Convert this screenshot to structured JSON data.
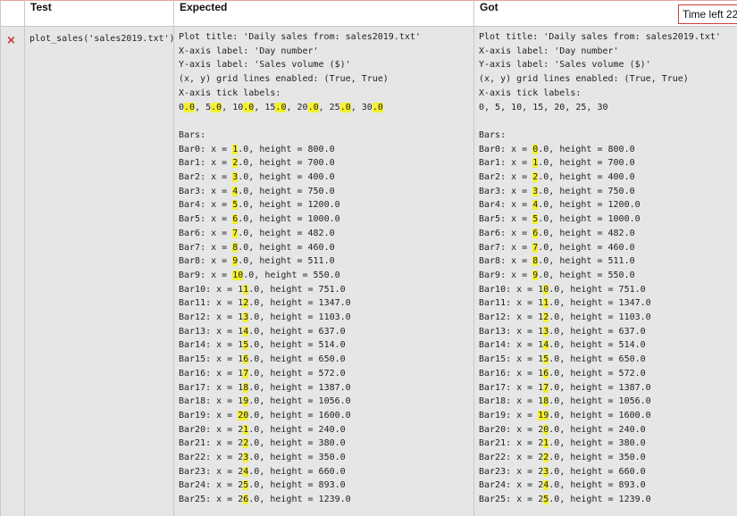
{
  "table": {
    "headers": {
      "icon": "",
      "test": "Test",
      "expected": "Expected",
      "got": "Got"
    },
    "row": {
      "status_icon": "×",
      "test_call": "plot_sales('sales2019.txt')",
      "expected_lines": [
        [
          {
            "t": "Plot title: 'Daily sales from: sales2019.txt'"
          }
        ],
        [
          {
            "t": "X-axis label: 'Day number'"
          }
        ],
        [
          {
            "t": "Y-axis label: 'Sales volume ($)'"
          }
        ],
        [
          {
            "t": "(x, y) grid lines enabled: (True, True)"
          }
        ],
        [
          {
            "t": "X-axis tick labels:"
          }
        ],
        [
          {
            "t": "0"
          },
          {
            "t": ".0",
            "h": true
          },
          {
            "t": ", 5"
          },
          {
            "t": ".0",
            "h": true
          },
          {
            "t": ", 10"
          },
          {
            "t": ".0",
            "h": true
          },
          {
            "t": ", 15"
          },
          {
            "t": ".0",
            "h": true
          },
          {
            "t": ", 20"
          },
          {
            "t": ".0",
            "h": true
          },
          {
            "t": ", 25"
          },
          {
            "t": ".0",
            "h": true
          },
          {
            "t": ", 30"
          },
          {
            "t": ".0",
            "h": true
          }
        ],
        [],
        [
          {
            "t": "Bars:"
          }
        ],
        [
          {
            "t": "Bar0: x = "
          },
          {
            "t": "1",
            "h": true
          },
          {
            "t": ".0, height = 800.0"
          }
        ],
        [
          {
            "t": "Bar1: x = "
          },
          {
            "t": "2",
            "h": true
          },
          {
            "t": ".0, height = 700.0"
          }
        ],
        [
          {
            "t": "Bar2: x = "
          },
          {
            "t": "3",
            "h": true
          },
          {
            "t": ".0, height = 400.0"
          }
        ],
        [
          {
            "t": "Bar3: x = "
          },
          {
            "t": "4",
            "h": true
          },
          {
            "t": ".0, height = 750.0"
          }
        ],
        [
          {
            "t": "Bar4: x = "
          },
          {
            "t": "5",
            "h": true
          },
          {
            "t": ".0, height = 1200.0"
          }
        ],
        [
          {
            "t": "Bar5: x = "
          },
          {
            "t": "6",
            "h": true
          },
          {
            "t": ".0, height = 1000.0"
          }
        ],
        [
          {
            "t": "Bar6: x = "
          },
          {
            "t": "7",
            "h": true
          },
          {
            "t": ".0, height = 482.0"
          }
        ],
        [
          {
            "t": "Bar7: x = "
          },
          {
            "t": "8",
            "h": true
          },
          {
            "t": ".0, height = 460.0"
          }
        ],
        [
          {
            "t": "Bar8: x = "
          },
          {
            "t": "9",
            "h": true
          },
          {
            "t": ".0, height = 511.0"
          }
        ],
        [
          {
            "t": "Bar9: x = "
          },
          {
            "t": "10",
            "h": true
          },
          {
            "t": ".0, height = 550.0"
          }
        ],
        [
          {
            "t": "Bar10: x = 1"
          },
          {
            "t": "1",
            "h": true
          },
          {
            "t": ".0, height = 751.0"
          }
        ],
        [
          {
            "t": "Bar11: x = 1"
          },
          {
            "t": "2",
            "h": true
          },
          {
            "t": ".0, height = 1347.0"
          }
        ],
        [
          {
            "t": "Bar12: x = 1"
          },
          {
            "t": "3",
            "h": true
          },
          {
            "t": ".0, height = 1103.0"
          }
        ],
        [
          {
            "t": "Bar13: x = 1"
          },
          {
            "t": "4",
            "h": true
          },
          {
            "t": ".0, height = 637.0"
          }
        ],
        [
          {
            "t": "Bar14: x = 1"
          },
          {
            "t": "5",
            "h": true
          },
          {
            "t": ".0, height = 514.0"
          }
        ],
        [
          {
            "t": "Bar15: x = 1"
          },
          {
            "t": "6",
            "h": true
          },
          {
            "t": ".0, height = 650.0"
          }
        ],
        [
          {
            "t": "Bar16: x = 1"
          },
          {
            "t": "7",
            "h": true
          },
          {
            "t": ".0, height = 572.0"
          }
        ],
        [
          {
            "t": "Bar17: x = 1"
          },
          {
            "t": "8",
            "h": true
          },
          {
            "t": ".0, height = 1387.0"
          }
        ],
        [
          {
            "t": "Bar18: x = 1"
          },
          {
            "t": "9",
            "h": true
          },
          {
            "t": ".0, height = 1056.0"
          }
        ],
        [
          {
            "t": "Bar19: x = "
          },
          {
            "t": "20",
            "h": true
          },
          {
            "t": ".0, height = 1600.0"
          }
        ],
        [
          {
            "t": "Bar20: x = 2"
          },
          {
            "t": "1",
            "h": true
          },
          {
            "t": ".0, height = 240.0"
          }
        ],
        [
          {
            "t": "Bar21: x = 2"
          },
          {
            "t": "2",
            "h": true
          },
          {
            "t": ".0, height = 380.0"
          }
        ],
        [
          {
            "t": "Bar22: x = 2"
          },
          {
            "t": "3",
            "h": true
          },
          {
            "t": ".0, height = 350.0"
          }
        ],
        [
          {
            "t": "Bar23: x = 2"
          },
          {
            "t": "4",
            "h": true
          },
          {
            "t": ".0, height = 660.0"
          }
        ],
        [
          {
            "t": "Bar24: x = 2"
          },
          {
            "t": "5",
            "h": true
          },
          {
            "t": ".0, height = 893.0"
          }
        ],
        [
          {
            "t": "Bar25: x = 2"
          },
          {
            "t": "6",
            "h": true
          },
          {
            "t": ".0, height = 1239.0"
          }
        ]
      ],
      "got_lines": [
        [
          {
            "t": "Plot title: 'Daily sales from: sales2019.txt'"
          }
        ],
        [
          {
            "t": "X-axis label: 'Day number'"
          }
        ],
        [
          {
            "t": "Y-axis label: 'Sales volume ($)'"
          }
        ],
        [
          {
            "t": "(x, y) grid lines enabled: (True, True)"
          }
        ],
        [
          {
            "t": "X-axis tick labels:"
          }
        ],
        [
          {
            "t": "0, 5, 10, 15, 20, 25, 30"
          }
        ],
        [],
        [
          {
            "t": "Bars:"
          }
        ],
        [
          {
            "t": "Bar0: x = "
          },
          {
            "t": "0",
            "h": true
          },
          {
            "t": ".0, height = 800.0"
          }
        ],
        [
          {
            "t": "Bar1: x = "
          },
          {
            "t": "1",
            "h": true
          },
          {
            "t": ".0, height = 700.0"
          }
        ],
        [
          {
            "t": "Bar2: x = "
          },
          {
            "t": "2",
            "h": true
          },
          {
            "t": ".0, height = 400.0"
          }
        ],
        [
          {
            "t": "Bar3: x = "
          },
          {
            "t": "3",
            "h": true
          },
          {
            "t": ".0, height = 750.0"
          }
        ],
        [
          {
            "t": "Bar4: x = "
          },
          {
            "t": "4",
            "h": true
          },
          {
            "t": ".0, height = 1200.0"
          }
        ],
        [
          {
            "t": "Bar5: x = "
          },
          {
            "t": "5",
            "h": true
          },
          {
            "t": ".0, height = 1000.0"
          }
        ],
        [
          {
            "t": "Bar6: x = "
          },
          {
            "t": "6",
            "h": true
          },
          {
            "t": ".0, height = 482.0"
          }
        ],
        [
          {
            "t": "Bar7: x = "
          },
          {
            "t": "7",
            "h": true
          },
          {
            "t": ".0, height = 460.0"
          }
        ],
        [
          {
            "t": "Bar8: x = "
          },
          {
            "t": "8",
            "h": true
          },
          {
            "t": ".0, height = 511.0"
          }
        ],
        [
          {
            "t": "Bar9: x = "
          },
          {
            "t": "9",
            "h": true
          },
          {
            "t": ".0, height = 550.0"
          }
        ],
        [
          {
            "t": "Bar10: x = 1"
          },
          {
            "t": "0",
            "h": true
          },
          {
            "t": ".0, height = 751.0"
          }
        ],
        [
          {
            "t": "Bar11: x = 1"
          },
          {
            "t": "1",
            "h": true
          },
          {
            "t": ".0, height = 1347.0"
          }
        ],
        [
          {
            "t": "Bar12: x = 1"
          },
          {
            "t": "2",
            "h": true
          },
          {
            "t": ".0, height = 1103.0"
          }
        ],
        [
          {
            "t": "Bar13: x = 1"
          },
          {
            "t": "3",
            "h": true
          },
          {
            "t": ".0, height = 637.0"
          }
        ],
        [
          {
            "t": "Bar14: x = 1"
          },
          {
            "t": "4",
            "h": true
          },
          {
            "t": ".0, height = 514.0"
          }
        ],
        [
          {
            "t": "Bar15: x = 1"
          },
          {
            "t": "5",
            "h": true
          },
          {
            "t": ".0, height = 650.0"
          }
        ],
        [
          {
            "t": "Bar16: x = 1"
          },
          {
            "t": "6",
            "h": true
          },
          {
            "t": ".0, height = 572.0"
          }
        ],
        [
          {
            "t": "Bar17: x = 1"
          },
          {
            "t": "7",
            "h": true
          },
          {
            "t": ".0, height = 1387.0"
          }
        ],
        [
          {
            "t": "Bar18: x = 1"
          },
          {
            "t": "8",
            "h": true
          },
          {
            "t": ".0, height = 1056.0"
          }
        ],
        [
          {
            "t": "Bar19: x = "
          },
          {
            "t": "19",
            "h": true
          },
          {
            "t": ".0, height = 1600.0"
          }
        ],
        [
          {
            "t": "Bar20: x = 2"
          },
          {
            "t": "0",
            "h": true
          },
          {
            "t": ".0, height = 240.0"
          }
        ],
        [
          {
            "t": "Bar21: x = 2"
          },
          {
            "t": "1",
            "h": true
          },
          {
            "t": ".0, height = 380.0"
          }
        ],
        [
          {
            "t": "Bar22: x = 2"
          },
          {
            "t": "2",
            "h": true
          },
          {
            "t": ".0, height = 350.0"
          }
        ],
        [
          {
            "t": "Bar23: x = 2"
          },
          {
            "t": "3",
            "h": true
          },
          {
            "t": ".0, height = 660.0"
          }
        ],
        [
          {
            "t": "Bar24: x = 2"
          },
          {
            "t": "4",
            "h": true
          },
          {
            "t": ".0, height = 893.0"
          }
        ],
        [
          {
            "t": "Bar25: x = 2"
          },
          {
            "t": "5",
            "h": true
          },
          {
            "t": ".0, height = 1239.0"
          }
        ]
      ]
    }
  },
  "timer": {
    "label": "Time left 22"
  },
  "colors": {
    "fail_icon": "#d22a2a",
    "highlight": "#f4f12a",
    "cell_bg": "#e6e6e6",
    "timer_border": "#d23a3a"
  }
}
